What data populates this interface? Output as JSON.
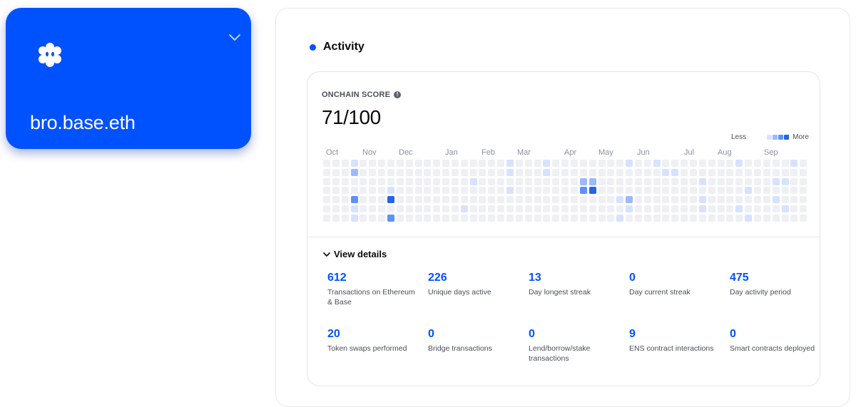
{
  "profile": {
    "name": "bro.base.eth",
    "logo_icon": "flower-face-icon",
    "chevron_icon": "chevron-down-icon",
    "card_color": "#0052ff"
  },
  "activity": {
    "title": "Activity",
    "accent_color": "#0052ff",
    "score": {
      "label": "ONCHAIN SCORE",
      "info_icon": "info-icon",
      "value": "71/100"
    },
    "legend": {
      "less": "Less",
      "more": "More",
      "colors": [
        "#eef0f4",
        "#d6e2ff",
        "#9bb9fb",
        "#5f91f7",
        "#2563eb"
      ]
    },
    "heatmap": {
      "months": [
        "Oct",
        "Nov",
        "Dec",
        "Jan",
        "Feb",
        "Mar",
        "Apr",
        "May",
        "Jun",
        "Jul",
        "Aug",
        "Sep"
      ],
      "weeks": 53,
      "days_per_week": 7,
      "active_cells": [
        {
          "week": 3,
          "day": 0,
          "level": 1
        },
        {
          "week": 3,
          "day": 1,
          "level": 2
        },
        {
          "week": 3,
          "day": 4,
          "level": 3
        },
        {
          "week": 3,
          "day": 5,
          "level": 1
        },
        {
          "week": 3,
          "day": 6,
          "level": 1
        },
        {
          "week": 7,
          "day": 3,
          "level": 1
        },
        {
          "week": 7,
          "day": 4,
          "level": 4
        },
        {
          "week": 7,
          "day": 6,
          "level": 3
        },
        {
          "week": 15,
          "day": 5,
          "level": 1
        },
        {
          "week": 16,
          "day": 2,
          "level": 1
        },
        {
          "week": 20,
          "day": 0,
          "level": 1
        },
        {
          "week": 20,
          "day": 1,
          "level": 1
        },
        {
          "week": 20,
          "day": 3,
          "level": 1
        },
        {
          "week": 24,
          "day": 0,
          "level": 1
        },
        {
          "week": 24,
          "day": 1,
          "level": 1
        },
        {
          "week": 28,
          "day": 2,
          "level": 2
        },
        {
          "week": 28,
          "day": 3,
          "level": 3
        },
        {
          "week": 29,
          "day": 2,
          "level": 2
        },
        {
          "week": 29,
          "day": 3,
          "level": 4
        },
        {
          "week": 32,
          "day": 4,
          "level": 1
        },
        {
          "week": 32,
          "day": 6,
          "level": 1
        },
        {
          "week": 33,
          "day": 0,
          "level": 1
        },
        {
          "week": 33,
          "day": 4,
          "level": 2
        },
        {
          "week": 33,
          "day": 5,
          "level": 1
        },
        {
          "week": 36,
          "day": 0,
          "level": 1
        },
        {
          "week": 37,
          "day": 1,
          "level": 1
        },
        {
          "week": 38,
          "day": 1,
          "level": 1
        },
        {
          "week": 41,
          "day": 2,
          "level": 1
        },
        {
          "week": 41,
          "day": 4,
          "level": 1
        },
        {
          "week": 41,
          "day": 5,
          "level": 1
        },
        {
          "week": 45,
          "day": 0,
          "level": 1
        },
        {
          "week": 45,
          "day": 5,
          "level": 1
        },
        {
          "week": 46,
          "day": 3,
          "level": 1
        },
        {
          "week": 46,
          "day": 6,
          "level": 1
        },
        {
          "week": 49,
          "day": 2,
          "level": 1
        },
        {
          "week": 49,
          "day": 4,
          "level": 1
        },
        {
          "week": 50,
          "day": 2,
          "level": 1
        },
        {
          "week": 50,
          "day": 5,
          "level": 1
        },
        {
          "week": 51,
          "day": 0,
          "level": 1
        }
      ]
    },
    "view_details_label": "View details",
    "stats": [
      {
        "value": "612",
        "label": "Transactions on Ethereum & Base"
      },
      {
        "value": "226",
        "label": "Unique days active"
      },
      {
        "value": "13",
        "label": "Day longest streak"
      },
      {
        "value": "0",
        "label": "Day current streak"
      },
      {
        "value": "475",
        "label": "Day activity period"
      },
      {
        "value": "20",
        "label": "Token swaps performed"
      },
      {
        "value": "0",
        "label": "Bridge transactions"
      },
      {
        "value": "0",
        "label": "Lend/borrow/stake transactions"
      },
      {
        "value": "9",
        "label": "ENS contract interactions"
      },
      {
        "value": "0",
        "label": "Smart contracts deployed"
      }
    ]
  }
}
